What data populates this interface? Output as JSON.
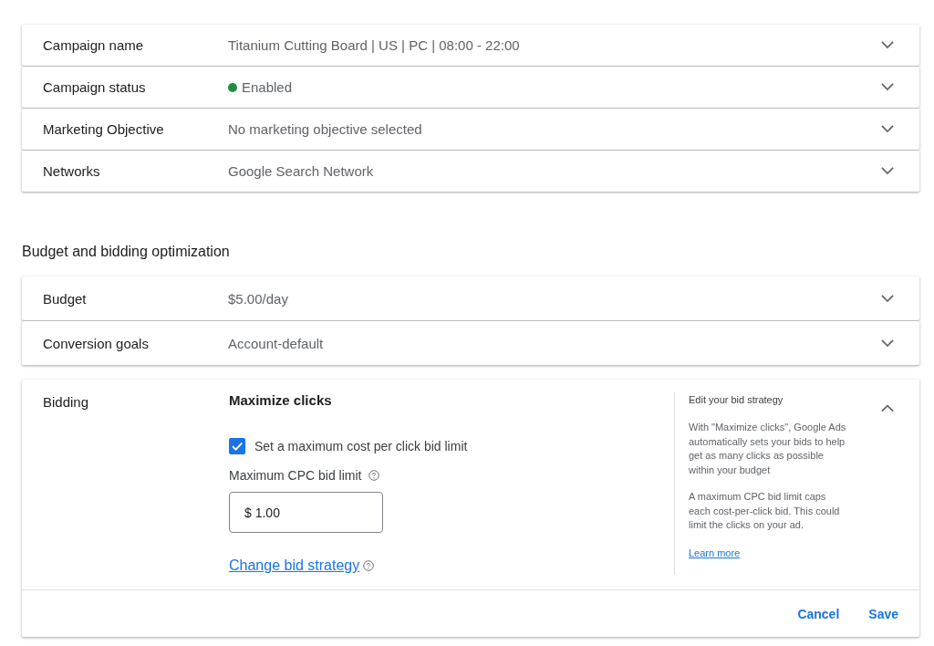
{
  "campaign_settings": [
    {
      "label": "Campaign name",
      "value": "Titanium Cutting Board | US | PC | 08:00 - 22:00",
      "expanded": false
    },
    {
      "label": "Campaign status",
      "value": "Enabled",
      "color": "#1e8e3e",
      "expanded": false
    },
    {
      "label": "Marketing Objective",
      "value": "No marketing objective selected",
      "expanded": false
    },
    {
      "label": "Networks",
      "value": "Google Search Network",
      "expanded": false
    }
  ],
  "budget_section": {
    "heading": "Budget and bidding optimization",
    "rows": [
      {
        "label": "Budget",
        "value": "$5.00/day",
        "expanded": false
      },
      {
        "label": "Conversion goals",
        "value": "Account-default",
        "expanded": false
      }
    ],
    "bidding": {
      "label": "Bidding",
      "expanded": true,
      "strategy": "Maximize clicks",
      "bid_limit_checkbox": {
        "label": "Set a maximum cost per click bid limit",
        "checked": true
      },
      "bid_limit_field": {
        "label": "Maximum CPC bid limit",
        "value": "$ 1.00"
      },
      "change_link": "Change bid strategy",
      "help": {
        "title": "Edit your bid strategy",
        "paragraphs": [
          "With \"Maximize clicks\", Google Ads automatically sets your bids to help get as many clicks as possible within your budget",
          "A maximum CPC bid limit caps each cost-per-click bid. This could limit the clicks on your ad."
        ],
        "link": "Learn more"
      },
      "buttons": [
        "Cancel",
        "Save"
      ]
    }
  }
}
